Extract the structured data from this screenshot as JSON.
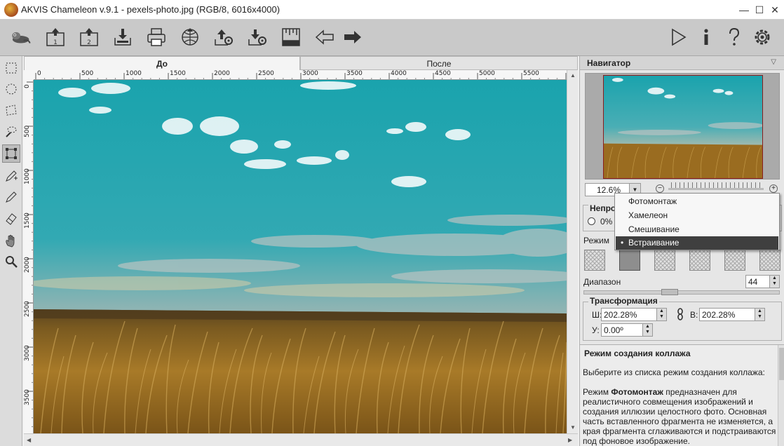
{
  "window": {
    "title": "AKVIS Chameleon v.9.1 - pexels-photo.jpg (RGB/8, 6016x4000)",
    "minimize": "—",
    "maximize": "☐",
    "close": "✕"
  },
  "toolbar": {
    "left_icons": [
      "chameleon-logo-icon",
      "open-image-1-icon",
      "open-image-2-icon",
      "save-icon",
      "print-icon",
      "share-icon",
      "settings-export-icon",
      "import-export-icon",
      "ruler-grid-icon",
      "undo-arrow-icon",
      "redo-arrow-icon"
    ],
    "open1_label": "1",
    "open2_label": "2",
    "right_icons": [
      "run-icon",
      "info-icon",
      "help-icon",
      "gear-icon"
    ]
  },
  "tools": [
    "rect-select-icon",
    "ellipse-select-icon",
    "lasso-select-icon",
    "magic-lasso-icon",
    "transform-icon",
    "pencil-plus-icon",
    "pencil-icon",
    "eraser-icon",
    "hand-icon",
    "zoom-icon"
  ],
  "tabs": {
    "before": "До",
    "after": "После"
  },
  "ruler": {
    "h_labels": [
      "0",
      "500",
      "1000",
      "1500",
      "2000",
      "2500",
      "3000",
      "3500",
      "4000",
      "4500",
      "5000",
      "5500"
    ],
    "v_labels": [
      "0",
      "500",
      "1000",
      "1500",
      "2000",
      "2500",
      "3000",
      "3500"
    ]
  },
  "navigator": {
    "title": "Навигатор",
    "zoom": "12.6%"
  },
  "opacity": {
    "title": "Непро",
    "value": "0%"
  },
  "mode": {
    "label": "Режим",
    "options": [
      "Фотомонтаж",
      "Хамелеон",
      "Смешивание",
      "Встраивание"
    ],
    "selected": "Встраивание",
    "bullet": "•"
  },
  "range": {
    "label": "Диапазон",
    "value": "44"
  },
  "transform": {
    "title": "Трансформация",
    "w_label": "Ш:",
    "w_value": "202.28%",
    "h_label": "В:",
    "h_value": "202.28%",
    "angle_label": "У:",
    "angle_value": "0.00º"
  },
  "help": {
    "title": "Режим создания коллажа",
    "intro": "Выберите из списка режим создания коллажа:",
    "para_pre": "Режим ",
    "para_bold": "Фотомонтаж",
    "para_post": " предназначен для реалистичного совмещения изображений и создания иллюзии целостного фото. Основная часть вставленного фрагмента не изменяется, а края фрагмента сглаживаются и подстраиваются под фоновое изображение."
  },
  "colors": {
    "sky_top": "#1aa3ad",
    "sky_bottom": "#9fb9b5",
    "field": "#9a6a1d",
    "selected_item": "#3f3f3f"
  }
}
